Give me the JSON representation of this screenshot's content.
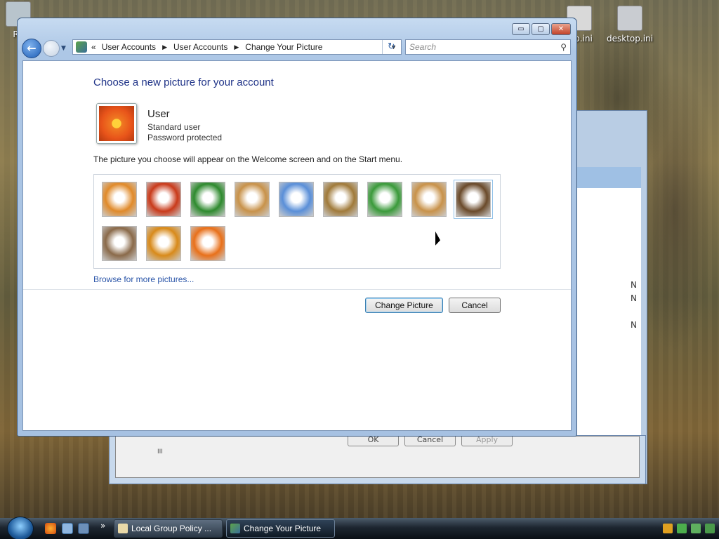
{
  "window": {
    "breadcrumb": [
      "User Accounts",
      "User Accounts",
      "Change Your Picture"
    ],
    "breadcrumb_prefix": "«",
    "search_placeholder": "Search",
    "controls": {
      "minimize": "▭",
      "maximize": "▢",
      "close": "✕"
    }
  },
  "content": {
    "heading": "Choose a new picture for your account",
    "user": {
      "name": "User",
      "type": "Standard user",
      "security": "Password protected"
    },
    "description": "The picture you choose will appear on the Welcome screen and on the Start menu.",
    "pictures": [
      {
        "name": "bass-clef",
        "color": "#e08a2a"
      },
      {
        "name": "starfish",
        "color": "#c93a1a"
      },
      {
        "name": "leaf",
        "color": "#2e8a2e"
      },
      {
        "name": "robot",
        "color": "#c8924a"
      },
      {
        "name": "goldfish",
        "color": "#5a8fd8"
      },
      {
        "name": "bonsai",
        "color": "#a07a3a"
      },
      {
        "name": "soccer-ball",
        "color": "#3a9a3a"
      },
      {
        "name": "dog",
        "color": "#c8924a"
      },
      {
        "name": "chess",
        "color": "#6a4a2a",
        "selected": true
      },
      {
        "name": "kitten",
        "color": "#8a6a4a"
      },
      {
        "name": "sparkles",
        "color": "#d88a1a"
      },
      {
        "name": "flower",
        "color": "#e8701a"
      }
    ],
    "browse_link": "Browse for more pictures...",
    "buttons": {
      "change": "Change Picture",
      "cancel": "Cancel"
    }
  },
  "desktop": {
    "icons": [
      "Re",
      "top.ini",
      "desktop.ini"
    ]
  },
  "background_window": {
    "buttons": [
      "OK",
      "Cancel",
      "Apply"
    ],
    "scroll_mark": "III",
    "side_letters": [
      "N",
      "N",
      "N"
    ]
  },
  "taskbar": {
    "items": [
      {
        "label": "Local Group Policy ...",
        "active": false
      },
      {
        "label": "Change Your Picture",
        "active": true
      }
    ],
    "overflow": "»"
  }
}
